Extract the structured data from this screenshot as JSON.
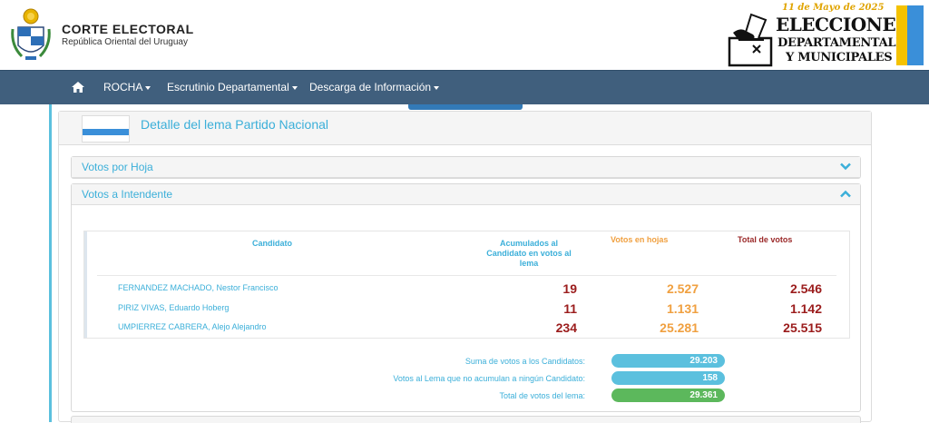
{
  "header": {
    "org_title": "CORTE ELECTORAL",
    "org_subtitle": "República Oriental del Uruguay",
    "election": {
      "date": "11 de Mayo de 2025",
      "line1": "ELECCIONES",
      "line2": "DEPARTAMENTALES",
      "line3": "Y MUNICIPALES"
    }
  },
  "nav": {
    "home_icon": "home-icon",
    "items": [
      {
        "label": "ROCHA"
      },
      {
        "label": "Escrutinio Departamental"
      },
      {
        "label": "Descarga de Información"
      }
    ]
  },
  "panel": {
    "title": "Detalle del lema Partido Nacional",
    "flag_colors": [
      "#ffffff",
      "#3a8fd9",
      "#ffffff"
    ],
    "sections": [
      {
        "title": "Votos por Hoja",
        "expanded": false,
        "icon": "chevron-down-icon"
      },
      {
        "title": "Votos a Intendente",
        "expanded": true,
        "icon": "chevron-up-icon"
      }
    ]
  },
  "table": {
    "headers": {
      "candidate": "Candidato",
      "accumulated": "Acumulados al Candidato en votos al lema",
      "sheet_votes": "Votos en hojas",
      "total": "Total de votos"
    },
    "rows": [
      {
        "name": "FERNANDEZ MACHADO, Nestor Francisco",
        "accumulated": "19",
        "sheet_votes": "2.527",
        "total": "2.546"
      },
      {
        "name": "PIRIZ VIVAS, Eduardo Hoberg",
        "accumulated": "11",
        "sheet_votes": "1.131",
        "total": "1.142"
      },
      {
        "name": "UMPIERREZ CABRERA, Alejo Alejandro",
        "accumulated": "234",
        "sheet_votes": "25.281",
        "total": "25.515"
      }
    ]
  },
  "summary": {
    "sum_candidates_label": "Suma de votos a los Candidatos:",
    "sum_candidates_value": "29.203",
    "non_accum_label": "Votos al Lema que no acumulan a ningún Candidato:",
    "non_accum_value": "158",
    "total_label": "Total de votos del lema:",
    "total_value": "29.361"
  },
  "colors": {
    "navbar": "#405f7d",
    "accent_cyan": "#3bafd9",
    "orange": "#f0a040",
    "dark_red": "#9b1c1c",
    "pill_blue": "#5bc0de",
    "pill_green": "#5cb85c"
  }
}
